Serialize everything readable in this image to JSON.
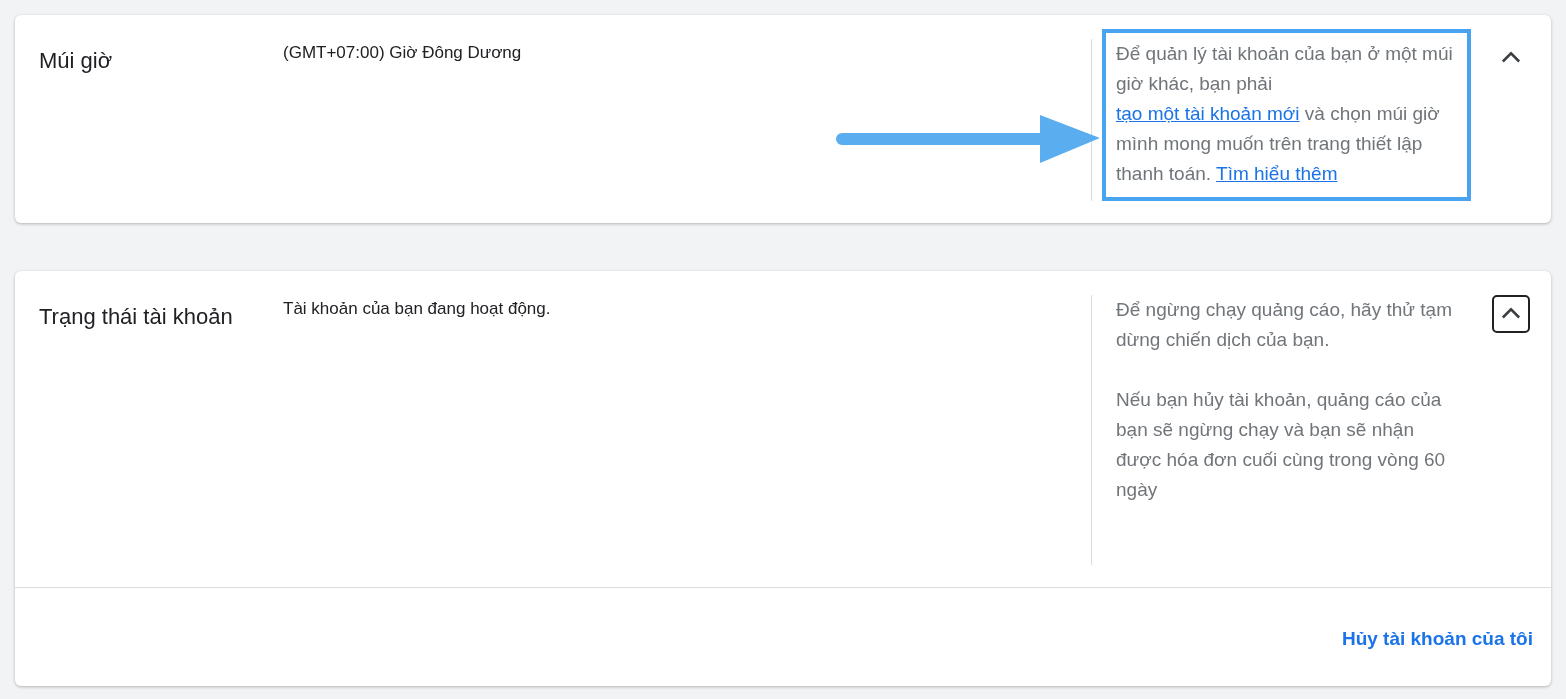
{
  "sections": [
    {
      "title": "Múi giờ",
      "value": "(GMT+07:00) Giờ Đông Dương",
      "highlighted": true,
      "pointer_arrow": true,
      "expanded": true,
      "focused": false,
      "help": [
        [
          {
            "kind": "text",
            "text": "Để quản lý tài khoản của bạn ở một múi giờ khác, bạn phải "
          },
          {
            "kind": "link",
            "text": "tạo một tài khoản mới"
          },
          {
            "kind": "text",
            "text": " và chọn múi giờ mình mong muốn trên trang thiết lập thanh toán. "
          },
          {
            "kind": "link",
            "text": "Tìm hiểu thêm"
          }
        ]
      ]
    },
    {
      "title": "Trạng thái tài khoản",
      "value": "Tài khoản của bạn đang hoạt động.",
      "highlighted": false,
      "pointer_arrow": false,
      "expanded": true,
      "focused": true,
      "help": [
        [
          {
            "kind": "text",
            "text": "Để ngừng chạy quảng cáo, hãy thử tạm dừng chiến dịch của bạn."
          }
        ],
        [
          {
            "kind": "text",
            "text": "Nếu bạn hủy tài khoản, quảng cáo của bạn sẽ ngừng chạy và bạn sẽ nhận được hóa đơn cuối cùng trong vòng 60 ngày"
          }
        ]
      ],
      "footer_link": "Hủy tài khoản của tôi"
    }
  ]
}
